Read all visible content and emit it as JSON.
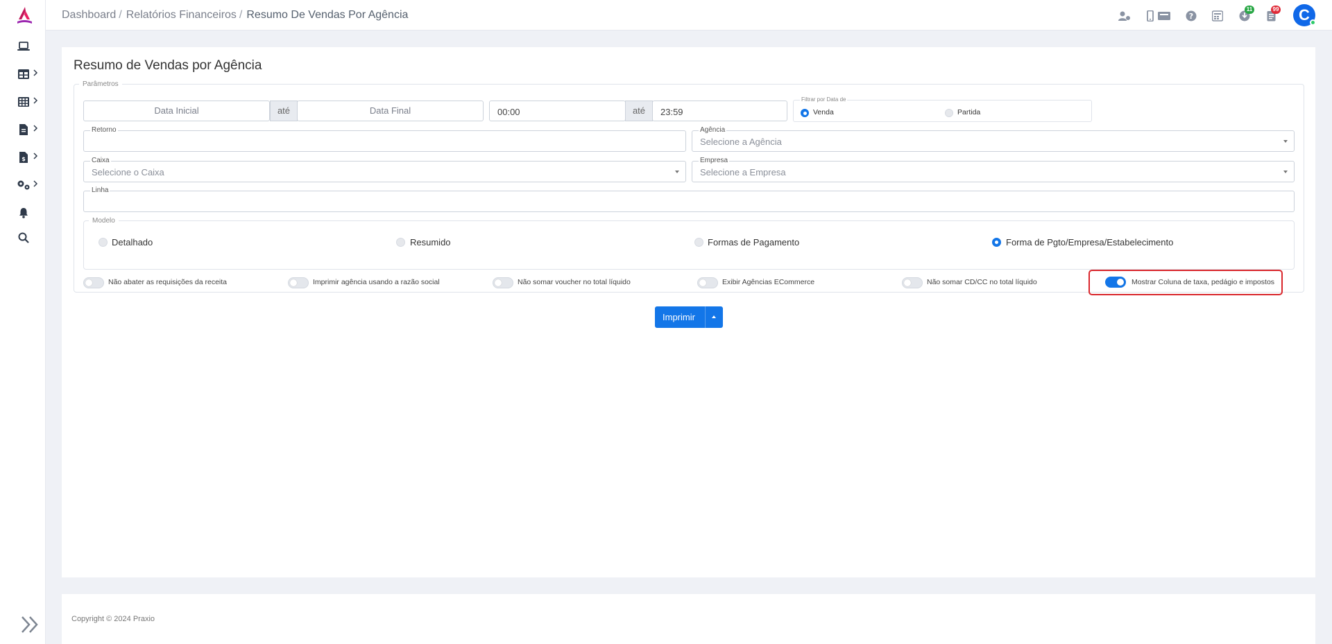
{
  "breadcrumb": {
    "item1": "Dashboard",
    "item2": "Relatórios Financeiros",
    "current": "Resumo De Vendas Por Agência",
    "sep": "/"
  },
  "badges": {
    "downloads": "11",
    "tasks": "99"
  },
  "avatar": {
    "initial": "C"
  },
  "page": {
    "title": "Resumo de Vendas por Agência"
  },
  "params": {
    "legend": "Parâmetros",
    "data_inicial_placeholder": "Data Inicial",
    "ate1": "até",
    "data_final_placeholder": "Data Final",
    "hora_inicial": "00:00",
    "ate2": "até",
    "hora_final": "23:59",
    "filtrar_legend": "Filtrar por Data de",
    "filtro_venda": "Venda",
    "filtro_partida": "Partida",
    "retorno_label": "Retorno",
    "agencia_label": "Agência",
    "agencia_placeholder": "Selecione a Agência",
    "caixa_label": "Caixa",
    "caixa_placeholder": "Selecione o Caixa",
    "empresa_label": "Empresa",
    "empresa_placeholder": "Selecione a Empresa",
    "linha_label": "Linha"
  },
  "modelo": {
    "legend": "Modelo",
    "options": [
      "Detalhado",
      "Resumido",
      "Formas de Pagamento",
      "Forma de Pgto/Empresa/Estabelecimento"
    ],
    "selected": "Forma de Pgto/Empresa/Estabelecimento"
  },
  "toggles": [
    {
      "label": "Não abater as requisições da receita",
      "on": false
    },
    {
      "label": "Imprimir agência usando a razão social",
      "on": false
    },
    {
      "label": "Não somar voucher no total líquido",
      "on": false
    },
    {
      "label": "Exibir Agências ECommerce",
      "on": false
    },
    {
      "label": "Não somar CD/CC no total líquido",
      "on": false
    },
    {
      "label": "Mostrar Coluna de taxa, pedágio e impostos",
      "on": true
    }
  ],
  "actions": {
    "print_label": "Imprimir"
  },
  "footer": {
    "copyright": "Copyright © 2024 Praxio"
  },
  "colors": {
    "primary": "#1376e8",
    "highlight": "#d9262b",
    "badge_green": "#28a745",
    "badge_red": "#e02a37"
  }
}
